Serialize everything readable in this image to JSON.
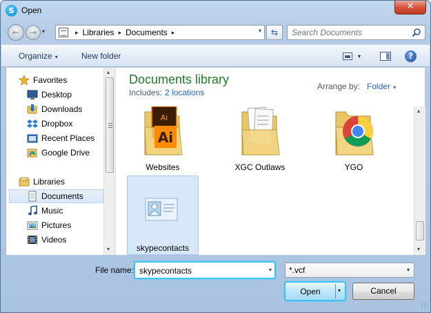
{
  "window": {
    "title": "Open",
    "app_icon": "skype-icon",
    "close_glyph": "✕"
  },
  "nav_buttons": {
    "back_glyph": "←",
    "forward_glyph": "→",
    "history_glyph": "▾"
  },
  "address": {
    "crumbs": [
      "Libraries",
      "Documents"
    ],
    "separator": "▸",
    "dropdown_glyph": "▾",
    "refresh_glyph": "⇆"
  },
  "search": {
    "placeholder": "Search Documents"
  },
  "toolbar": {
    "organize": "Organize",
    "new_folder": "New folder",
    "caret": "▾",
    "help": "?"
  },
  "sidebar": {
    "favorites_label": "Favorites",
    "favorites": [
      {
        "label": "Desktop",
        "icon": "desktop-icon"
      },
      {
        "label": "Downloads",
        "icon": "downloads-icon"
      },
      {
        "label": "Dropbox",
        "icon": "dropbox-icon"
      },
      {
        "label": "Recent Places",
        "icon": "recent-places-icon"
      },
      {
        "label": "Google Drive",
        "icon": "google-drive-icon"
      }
    ],
    "libraries_label": "Libraries",
    "libraries": [
      {
        "label": "Documents",
        "icon": "documents-icon",
        "selected": true
      },
      {
        "label": "Music",
        "icon": "music-icon"
      },
      {
        "label": "Pictures",
        "icon": "pictures-icon"
      },
      {
        "label": "Videos",
        "icon": "videos-icon"
      }
    ],
    "scroll_up": "▴",
    "scroll_down": "▾"
  },
  "library": {
    "title": "Documents library",
    "includes_label": "Includes:",
    "includes_link": "2 locations",
    "arrange_label": "Arrange by:",
    "arrange_value": "Folder",
    "caret": "▾"
  },
  "items": [
    {
      "label": "Websites",
      "type": "folder",
      "badge": "Ai"
    },
    {
      "label": "XGC Outlaws",
      "type": "folder"
    },
    {
      "label": "YGO",
      "type": "folder",
      "badge": "chrome"
    },
    {
      "label": "skypecontacts",
      "type": "vcf",
      "selected": true
    }
  ],
  "footer": {
    "file_name_label": "File name:",
    "file_name_value": "skypecontacts",
    "file_type": "*.vcf",
    "open_label": "Open",
    "cancel_label": "Cancel",
    "caret": "▾"
  },
  "colors": {
    "library_title": "#1e7a25",
    "link": "#1e64c8",
    "focus_ring": "#3cc0f4"
  }
}
